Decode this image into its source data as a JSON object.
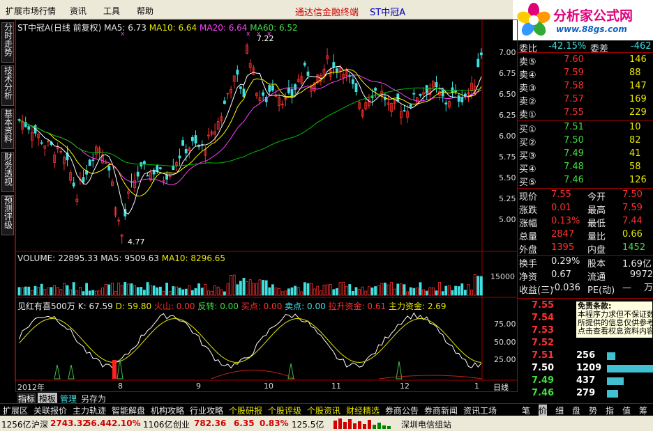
{
  "menu": {
    "items": [
      "扩展市场行情",
      "资讯",
      "工具",
      "帮助"
    ],
    "title": "通达信金融终端",
    "stock": "ST中冠A"
  },
  "logo": {
    "name": "分析家公式网",
    "url": "www.88gs.com"
  },
  "left_tabs": [
    "分时走势",
    "技术分析",
    "基本资料",
    "财务透视",
    "预测评级"
  ],
  "main_chart": {
    "name": "ST中冠A(日线 前复权)",
    "ma5": "MA5: 6.73",
    "ma10": "MA10: 6.64",
    "ma20": "MA20: 6.64",
    "ma60": "MA60: 6.52",
    "high_label": "7.22",
    "low_label": "4.77",
    "y_labels": [
      "7.00",
      "6.75",
      "6.50",
      "6.25",
      "6.00",
      "5.75",
      "5.50",
      "5.25",
      "5.00"
    ]
  },
  "volume": {
    "label": "VOLUME: 22895.33",
    "ma5": "MA5: 9509.63",
    "ma10": "MA10: 8296.65",
    "y_label": "15000"
  },
  "indicator": {
    "name": "见红有喜500万",
    "k": "K: 67.59",
    "d": "D: 59.80",
    "huoshan": "火山: 0.00",
    "fanzhuan": "反转: 0.00",
    "maidian": "买点: 0.00",
    "maichu": "卖点: 0.00",
    "lashen": "拉升资金: 0.61",
    "zhuli": "主力资金: 2.69",
    "y_labels": [
      "75.00",
      "50.00",
      "25.00"
    ]
  },
  "x_axis": {
    "labels": [
      "2012年",
      "8",
      "9",
      "10",
      "11",
      "12",
      "1"
    ],
    "period": "日线"
  },
  "quote": {
    "top": {
      "weibi_label": "委比",
      "weibi": "-42.15%",
      "weicha_label": "委差",
      "weicha": "-462"
    },
    "sell": [
      {
        "label": "卖⑤",
        "price": "7.60",
        "vol": "146"
      },
      {
        "label": "卖④",
        "price": "7.59",
        "vol": "88"
      },
      {
        "label": "卖③",
        "price": "7.58",
        "vol": "147"
      },
      {
        "label": "卖②",
        "price": "7.57",
        "vol": "169"
      },
      {
        "label": "卖①",
        "price": "7.55",
        "vol": "229"
      }
    ],
    "buy": [
      {
        "label": "买①",
        "price": "7.51",
        "vol": "10"
      },
      {
        "label": "买②",
        "price": "7.50",
        "vol": "82"
      },
      {
        "label": "买③",
        "price": "7.49",
        "vol": "41"
      },
      {
        "label": "买④",
        "price": "7.48",
        "vol": "58"
      },
      {
        "label": "买⑤",
        "price": "7.46",
        "vol": "126"
      }
    ],
    "stats": [
      {
        "l1": "现价",
        "v1": "7.55",
        "l2": "今开",
        "v2": "7.50"
      },
      {
        "l1": "涨跌",
        "v1": "0.01",
        "l2": "最高",
        "v2": "7.59"
      },
      {
        "l1": "涨幅",
        "v1": "0.13%",
        "l2": "最低",
        "v2": "7.44"
      },
      {
        "l1": "总量",
        "v1": "2847",
        "l2": "量比",
        "v2": "0.66"
      },
      {
        "l1": "外盘",
        "v1": "1395",
        "l2": "内盘",
        "v2": "1452"
      }
    ],
    "stats2": [
      {
        "l1": "换手",
        "v1": "0.29%",
        "l2": "股本",
        "v2": "1.69亿"
      },
      {
        "l1": "净资",
        "v1": "0.67",
        "l2": "流通",
        "v2": "9972万"
      },
      {
        "l1": "收益(三)",
        "v1": "-0.036",
        "l2": "PE(动)",
        "v2": "—"
      }
    ]
  },
  "ticks": [
    {
      "price": "7.55",
      "vol": ""
    },
    {
      "price": "7.54",
      "vol": ""
    },
    {
      "price": "7.53",
      "vol": ""
    },
    {
      "price": "7.52",
      "vol": ""
    },
    {
      "price": "7.51",
      "vol": "256"
    },
    {
      "price": "7.50",
      "vol": "1209"
    },
    {
      "price": "7.49",
      "vol": "437"
    },
    {
      "price": "7.46",
      "vol": "279"
    }
  ],
  "tooltip": {
    "title": "免责条款:",
    "lines": [
      "本程序力求但不保证数",
      "所提供的信息仅供参考",
      "点击查看权息资料内容"
    ]
  },
  "bottom_tabs": [
    "指标",
    "模板",
    "管理",
    "另存为"
  ],
  "nav_tabs": [
    "扩展区",
    "关联报价",
    "主力轨迹",
    "智能解盘",
    "机构攻略",
    "行业攻略",
    "个股研报",
    "个股评级",
    "个股资讯",
    "财经精选",
    "券商公告",
    "券商新闻",
    "资讯工场"
  ],
  "right_nav": [
    "笔",
    "价",
    "细",
    "盘",
    "势",
    "指",
    "值",
    "筹"
  ],
  "status": {
    "vol1": "1256亿",
    "sz_label": "沪深",
    "sz": "2743.32",
    "sz_chg": "56.44",
    "sz_pct": "2.10%",
    "vol2": "1106亿",
    "cy_label": "创业",
    "cy": "782.36",
    "cy_chg": "6.35",
    "cy_pct": "0.83%",
    "vol3": "125.5亿",
    "server": "深圳电信组站"
  },
  "colors": {
    "up": "#ff3030",
    "down": "#40e0e0",
    "ma5": "#ffffff",
    "ma10": "#ffff00",
    "ma20": "#ff40ff",
    "ma60": "#00c000",
    "frame": "#a00000"
  }
}
